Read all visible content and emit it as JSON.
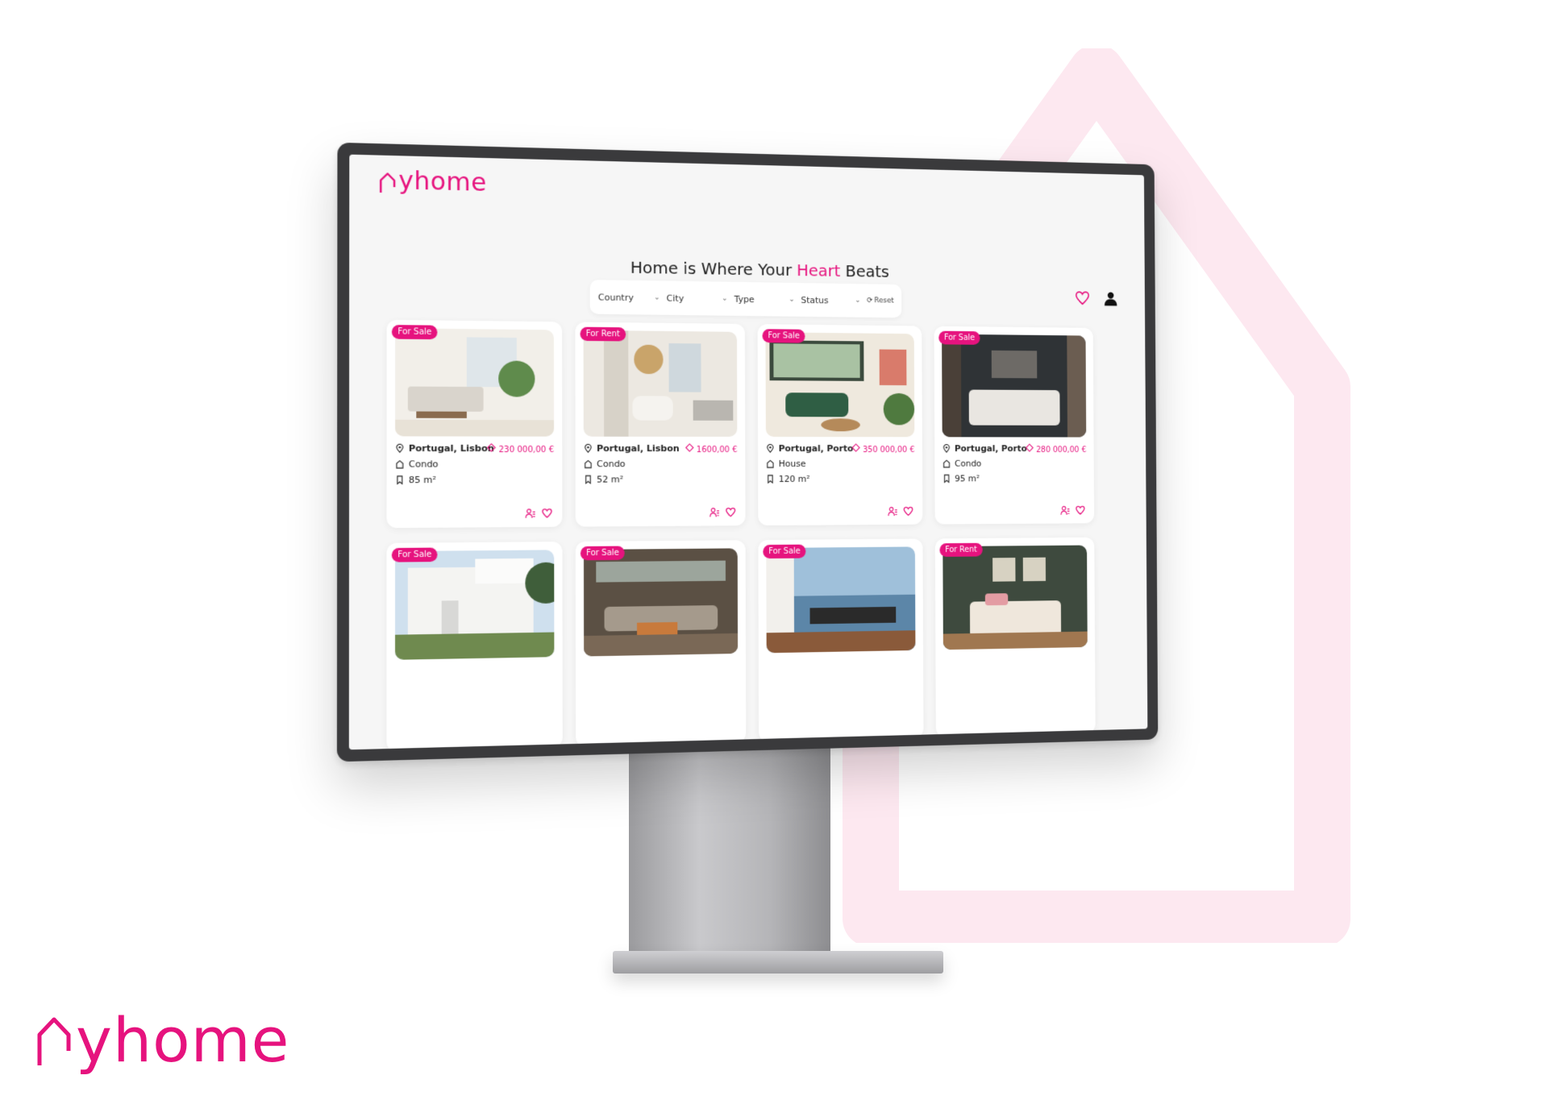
{
  "brand": {
    "name": "yhome",
    "color": "#e6137e"
  },
  "headline": {
    "before": "Home is Where Your ",
    "accent": "Heart",
    "after": " Beats"
  },
  "filters": [
    {
      "label": "Country"
    },
    {
      "label": "City"
    },
    {
      "label": "Type"
    },
    {
      "label": "Status"
    }
  ],
  "reset_label": "Reset",
  "header_icons": [
    "heart-icon",
    "user-icon"
  ],
  "listings": [
    {
      "badge": "For Sale",
      "location": "Portugal, Lisbon",
      "price": "230 000,00 €",
      "type": "Condo",
      "area": "85 m²",
      "scene": "living"
    },
    {
      "badge": "For Rent",
      "location": "Portugal, Lisbon",
      "price": "1600,00 €",
      "type": "Condo",
      "area": "52 m²",
      "scene": "dining"
    },
    {
      "badge": "For Sale",
      "location": "Portugal, Porto",
      "price": "350 000,00 €",
      "type": "House",
      "area": "120 m²",
      "scene": "green"
    },
    {
      "badge": "For Sale",
      "location": "Portugal, Porto",
      "price": "280 000,00 €",
      "type": "Condo",
      "area": "95 m²",
      "scene": "bedroom"
    },
    {
      "badge": "For Sale",
      "location": "",
      "price": "",
      "type": "",
      "area": "",
      "scene": "exterior"
    },
    {
      "badge": "For Sale",
      "location": "",
      "price": "",
      "type": "",
      "area": "",
      "scene": "lounge"
    },
    {
      "badge": "For Sale",
      "location": "",
      "price": "",
      "type": "",
      "area": "",
      "scene": "seaview"
    },
    {
      "badge": "For Rent",
      "location": "",
      "price": "",
      "type": "",
      "area": "",
      "scene": "bedroom2"
    }
  ]
}
